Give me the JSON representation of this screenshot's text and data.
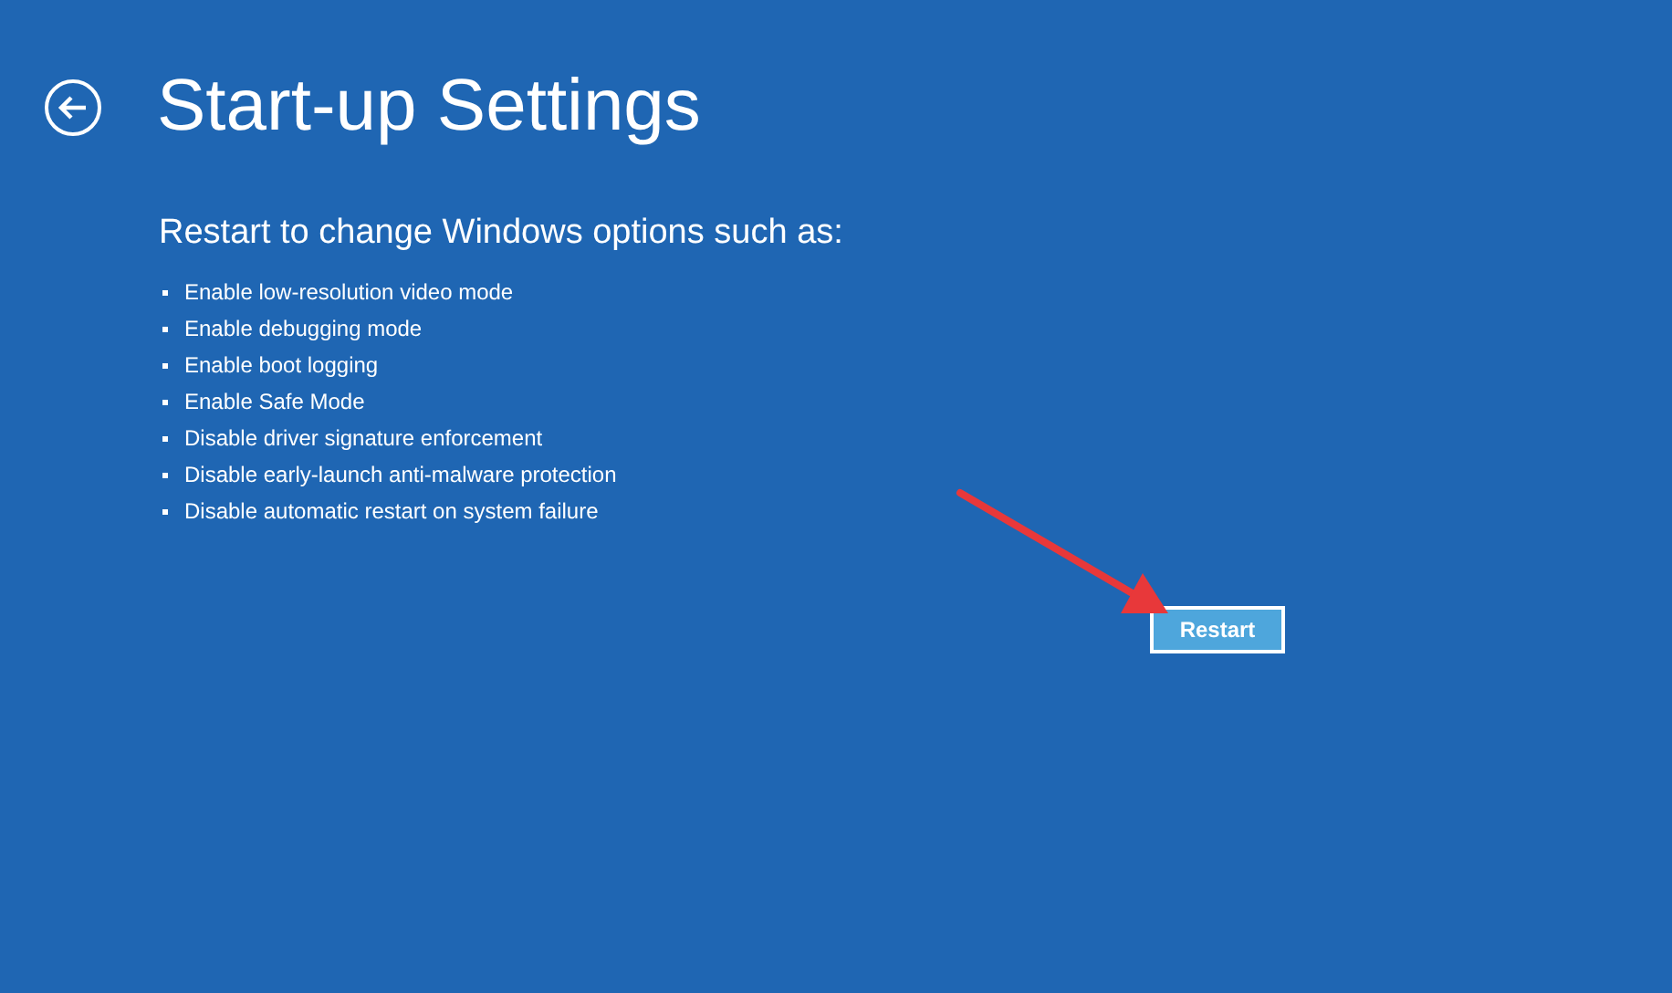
{
  "title": "Start-up Settings",
  "subtitle": "Restart to change Windows options such as:",
  "options": [
    "Enable low-resolution video mode",
    "Enable debugging mode",
    "Enable boot logging",
    "Enable Safe Mode",
    "Disable driver signature enforcement",
    "Disable early-launch anti-malware protection",
    "Disable automatic restart on system failure"
  ],
  "button": "Restart"
}
